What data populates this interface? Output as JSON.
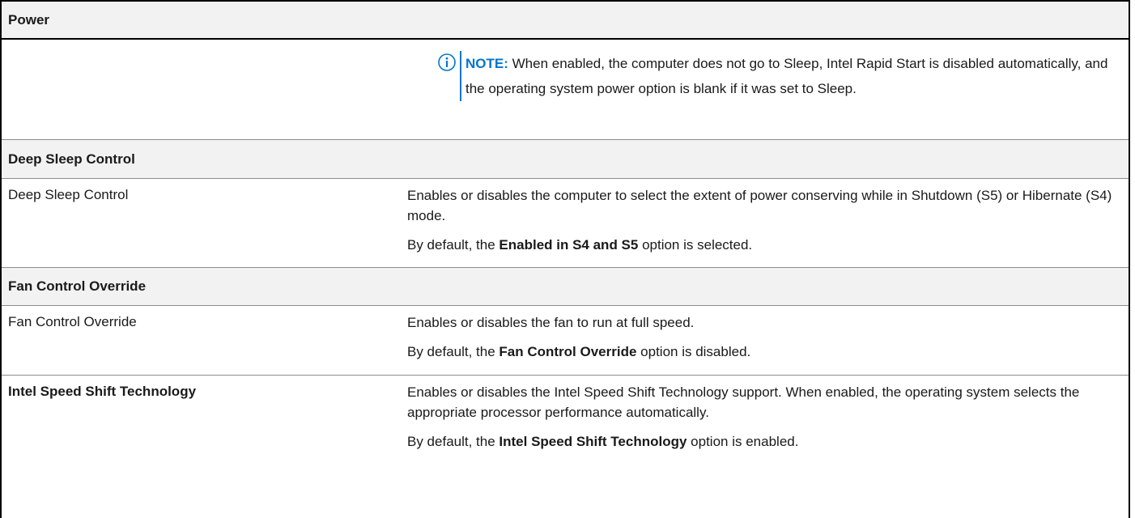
{
  "power_header": "Power",
  "note": {
    "icon": "info-icon",
    "label": "NOTE:",
    "text": " When enabled, the computer does not go to Sleep, Intel Rapid Start is disabled automatically, and the operating system power option is blank if it was set to Sleep."
  },
  "deep_sleep": {
    "section_header": "Deep Sleep Control",
    "name": "Deep Sleep Control",
    "description": "Enables or disables the computer to select the extent of power conserving while in Shutdown (S5) or Hibernate (S4) mode.",
    "default_prefix": "By default, the ",
    "default_value": "Enabled in S4 and S5",
    "default_suffix": " option is selected."
  },
  "fan_control": {
    "section_header": "Fan Control Override",
    "name": "Fan Control Override",
    "description": "Enables or disables the fan to run at full speed.",
    "default_prefix": "By default, the ",
    "default_value": "Fan Control Override",
    "default_suffix": " option is disabled."
  },
  "speed_shift": {
    "name": "Intel Speed Shift Technology",
    "description": "Enables or disables the Intel Speed Shift Technology support. When enabled, the operating system selects the appropriate processor performance automatically.",
    "default_prefix": "By default, the ",
    "default_value": "Intel Speed Shift Technology",
    "default_suffix": " option is enabled."
  },
  "colors": {
    "accent": "#0076ce",
    "header_bg": "#f2f2f2"
  }
}
